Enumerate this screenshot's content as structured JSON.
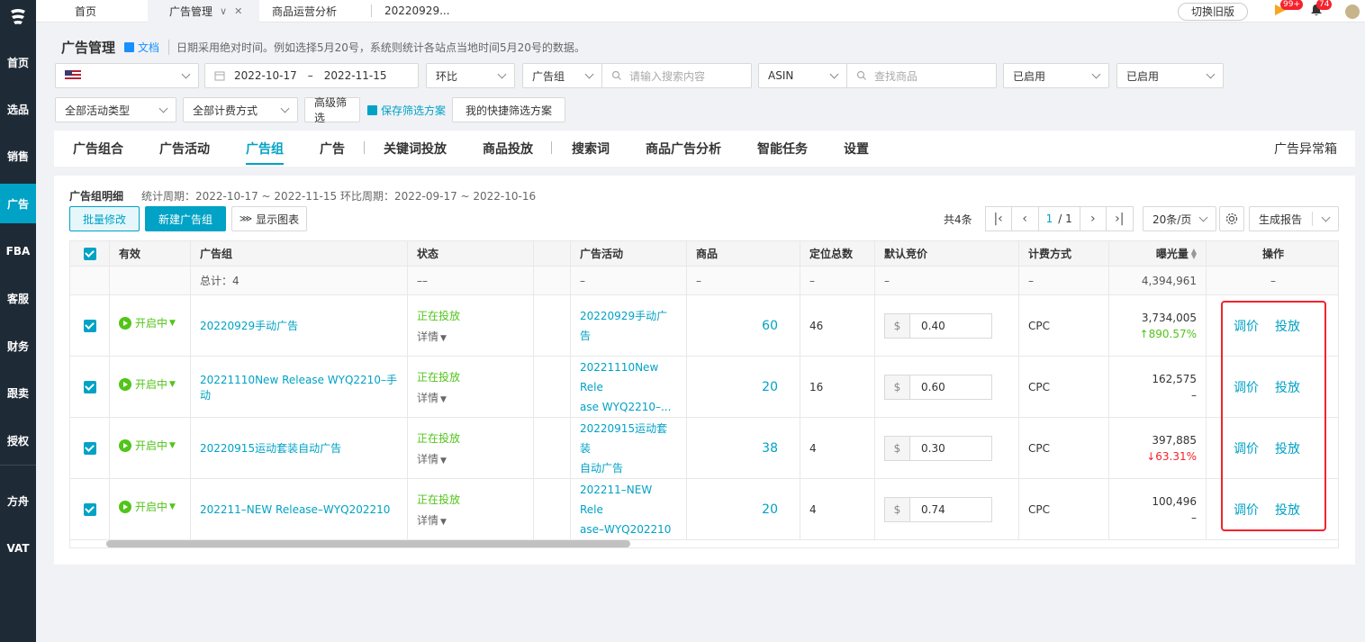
{
  "sidebar": {
    "items": [
      {
        "label": "首页",
        "active": false
      },
      {
        "label": "选品",
        "active": false
      },
      {
        "label": "销售",
        "active": false
      },
      {
        "label": "广告",
        "active": true
      },
      {
        "label": "FBA",
        "active": false
      },
      {
        "label": "客服",
        "active": false
      },
      {
        "label": "财务",
        "active": false
      },
      {
        "label": "跟卖",
        "active": false
      },
      {
        "label": "授权",
        "active": false
      },
      {
        "label": "方舟",
        "active": false
      },
      {
        "label": "VAT",
        "active": false
      }
    ]
  },
  "topbar": {
    "tabs": [
      {
        "label": "首页"
      },
      {
        "label": "广告管理"
      },
      {
        "label": "商品运营分析"
      },
      {
        "label": "20220929..."
      }
    ],
    "old_version": "切换旧版",
    "flag_badge": "99+",
    "bell_badge": "74"
  },
  "header": {
    "title": "广告管理",
    "doc": "文档",
    "hint": "日期采用绝对时间。例如选择5月20号，系统则统计各站点当地时间5月20号的数据。"
  },
  "filters": {
    "date_start": "2022-10-17",
    "date_sep": "–",
    "date_end": "2022-11-15",
    "compare": "环比",
    "group_type": "广告组",
    "search_placeholder": "请输入搜索内容",
    "asin": "ASIN",
    "product_placeholder": "查找商品",
    "enabled1": "已启用",
    "enabled2": "已启用",
    "activity_type": "全部活动类型",
    "billing_type": "全部计费方式",
    "advanced": "高级筛选",
    "save_scheme": "保存筛选方案",
    "my_scheme": "我的快捷筛选方案"
  },
  "nav": {
    "tabs": [
      "广告组合",
      "广告活动",
      "广告组",
      "广告",
      "关键词投放",
      "商品投放",
      "搜索词",
      "商品广告分析",
      "智能任务",
      "设置"
    ],
    "anomaly": "广告异常箱"
  },
  "section": {
    "title": "广告组明细",
    "period": "统计周期：2022-10-17 ~ 2022-11-15 环比周期：2022-09-17 ~ 2022-10-16",
    "batch_edit": "批量修改",
    "new_group": "新建广告组",
    "show_chart": "显示图表",
    "total_count": "共4条",
    "page_current": "1",
    "page_total": "/ 1",
    "page_size": "20条/页",
    "report": "生成报告"
  },
  "table": {
    "headers": {
      "valid": "有效",
      "group": "广告组",
      "status": "状态",
      "campaign": "广告活动",
      "products": "商品",
      "targets": "定位总数",
      "bid": "默认竞价",
      "billing": "计费方式",
      "impressions": "曝光量",
      "ops": "操作"
    },
    "total": {
      "group": "总计：4",
      "status": "––",
      "campaign": "–",
      "products": "–",
      "targets": "–",
      "bid": "–",
      "billing": "–",
      "impressions": "4,394,961",
      "ops": "–"
    },
    "rows": [
      {
        "valid": "开启中",
        "group": "20220929手动广告",
        "status": "正在投放",
        "detail": "详情",
        "campaign_l1": "20220929手动广告",
        "campaign_l2": "",
        "products": "60",
        "targets": "46",
        "currency": "$",
        "bid": "0.40",
        "billing": "CPC",
        "impressions": "3,734,005",
        "change": "↑890.57%",
        "op1": "调价",
        "op2": "投放"
      },
      {
        "valid": "开启中",
        "group": "20221110New Release WYQ2210–手动",
        "status": "正在投放",
        "detail": "详情",
        "campaign_l1": "20221110New Rele",
        "campaign_l2": "ase WYQ2210–...",
        "products": "20",
        "targets": "16",
        "currency": "$",
        "bid": "0.60",
        "billing": "CPC",
        "impressions": "162,575",
        "change": "–",
        "op1": "调价",
        "op2": "投放"
      },
      {
        "valid": "开启中",
        "group": "20220915运动套装自动广告",
        "status": "正在投放",
        "detail": "详情",
        "campaign_l1": "20220915运动套装",
        "campaign_l2": "自动广告",
        "products": "38",
        "targets": "4",
        "currency": "$",
        "bid": "0.30",
        "billing": "CPC",
        "impressions": "397,885",
        "change": "↓63.31%",
        "op1": "调价",
        "op2": "投放"
      },
      {
        "valid": "开启中",
        "group": "202211–NEW Release–WYQ202210",
        "status": "正在投放",
        "detail": "详情",
        "campaign_l1": "202211–NEW Rele",
        "campaign_l2": "ase–WYQ202210",
        "products": "20",
        "targets": "4",
        "currency": "$",
        "bid": "0.74",
        "billing": "CPC",
        "impressions": "100,496",
        "change": "–",
        "op1": "调价",
        "op2": "投放"
      }
    ]
  },
  "colors": {
    "accent": "#00a2c5",
    "sidebar": "#1f2a37",
    "green": "#52c41a",
    "red": "#f5222d"
  }
}
